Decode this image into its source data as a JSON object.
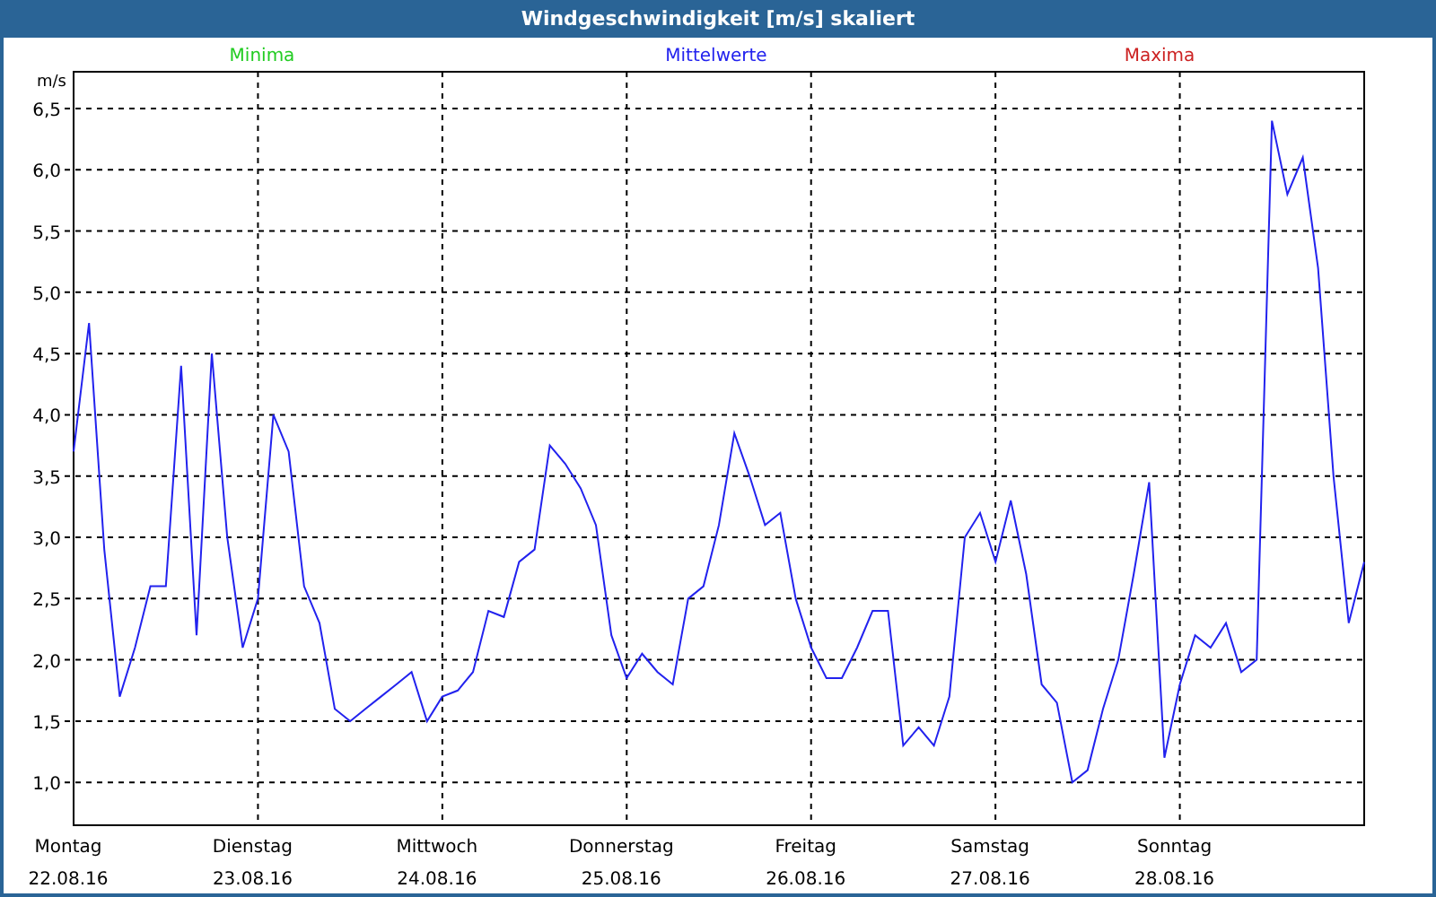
{
  "window": {
    "title": "Windgeschwindigkeit [m/s] skaliert"
  },
  "chart": {
    "legend": [
      {
        "label": "Minima",
        "color": "#22cc22"
      },
      {
        "label": "Maxima",
        "color": "#cc2222"
      }
    ],
    "date_labels": [
      "22.08.16",
      "23.08.16",
      "24.08.16",
      "25.08.16",
      "26.08.16",
      "27.08.16",
      "28.08.16"
    ],
    "chart_data": {
      "type": "line",
      "grid": true,
      "ylabel": "m/s",
      "ylim": [
        0.65,
        6.8
      ],
      "categories": [
        "Montag",
        null,
        null,
        null,
        null,
        null,
        null,
        null,
        null,
        null,
        null,
        null,
        "Dienstag",
        null,
        null,
        null,
        null,
        null,
        null,
        null,
        null,
        null,
        null,
        null,
        "Mittwoch",
        null,
        null,
        null,
        null,
        null,
        null,
        null,
        null,
        null,
        null,
        null,
        "Donnerstag",
        null,
        null,
        null,
        null,
        null,
        null,
        null,
        null,
        null,
        null,
        null,
        "Freitag",
        null,
        null,
        null,
        null,
        null,
        null,
        null,
        null,
        null,
        null,
        null,
        "Samstag",
        null,
        null,
        null,
        null,
        null,
        null,
        null,
        null,
        null,
        null,
        null,
        "Sonntag",
        null,
        null,
        null,
        null,
        null,
        null,
        null,
        null,
        null,
        null,
        null,
        null
      ],
      "series": [
        {
          "name": "Mittelwerte",
          "color": "#2222ee",
          "values": [
            3.7,
            4.75,
            2.9,
            1.7,
            2.1,
            2.6,
            2.6,
            4.4,
            2.2,
            4.5,
            3.0,
            2.1,
            2.5,
            4.0,
            3.7,
            2.6,
            2.3,
            1.6,
            1.5,
            1.6,
            1.7,
            1.8,
            1.9,
            1.5,
            1.7,
            1.75,
            1.9,
            2.4,
            2.35,
            2.8,
            2.9,
            3.75,
            3.6,
            3.4,
            3.1,
            2.2,
            1.85,
            2.05,
            1.9,
            1.8,
            2.5,
            2.6,
            3.1,
            3.85,
            3.5,
            3.1,
            3.2,
            2.5,
            2.1,
            1.85,
            1.85,
            2.1,
            2.4,
            2.4,
            1.3,
            1.45,
            1.3,
            1.7,
            3.0,
            3.2,
            2.8,
            3.3,
            2.7,
            1.8,
            1.65,
            1.0,
            1.1,
            1.6,
            2.0,
            2.7,
            3.45,
            1.2,
            1.8,
            2.2,
            2.1,
            2.3,
            1.9,
            2.0,
            6.4,
            5.8,
            6.1,
            5.2,
            3.5,
            2.3,
            2.8
          ]
        }
      ],
      "yticks": [
        {
          "value": 1.0,
          "label": "1,0"
        },
        {
          "value": 1.5,
          "label": "1,5"
        },
        {
          "value": 2.0,
          "label": "2,0"
        },
        {
          "value": 2.5,
          "label": "2,5"
        },
        {
          "value": 3.0,
          "label": "3,0"
        },
        {
          "value": 3.5,
          "label": "3,5"
        },
        {
          "value": 4.0,
          "label": "4,0"
        },
        {
          "value": 4.5,
          "label": "4,5"
        },
        {
          "value": 5.0,
          "label": "5,0"
        },
        {
          "value": 5.5,
          "label": "5,5"
        },
        {
          "value": 6.0,
          "label": "6,0"
        },
        {
          "value": 6.5,
          "label": "6,5"
        }
      ]
    }
  }
}
